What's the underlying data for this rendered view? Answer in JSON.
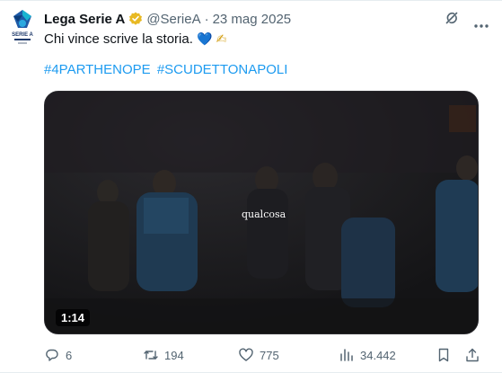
{
  "tweet": {
    "author_name": "Lega Serie A",
    "handle": "@SerieA",
    "separator": "·",
    "date": "23 mag 2025",
    "text": "Chi vince scrive la storia.",
    "emojis": [
      "💙",
      "✍"
    ],
    "hashtags": [
      "#4PARTHENOPE",
      "#SCUDETTONAPOLI"
    ],
    "verified_color": "#e8b923",
    "hashtag_color": "#1d9bf0",
    "avatar_logo_text": "SERIE A"
  },
  "media": {
    "caption": "qualcosa",
    "duration": "1:14"
  },
  "actions": {
    "replies": "6",
    "retweets": "194",
    "likes": "775",
    "views": "34.442"
  },
  "icons": {
    "reply": "reply-icon",
    "retweet": "retweet-icon",
    "like": "heart-icon",
    "views": "views-icon",
    "bookmark": "bookmark-icon",
    "share": "share-icon",
    "grok": "grok-icon",
    "more": "more-icon"
  }
}
